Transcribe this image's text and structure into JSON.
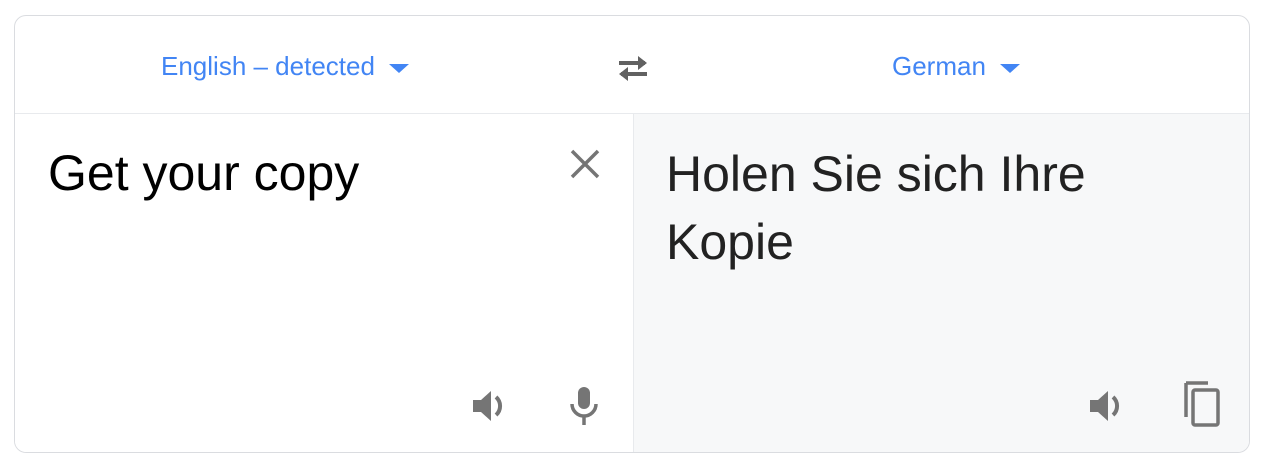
{
  "languages": {
    "source_label": "English – detected",
    "target_label": "German"
  },
  "source": {
    "text": "Get your copy"
  },
  "target": {
    "text": "Holen Sie sich Ihre Kopie"
  },
  "icons": {
    "dropdown": "caret-down-icon",
    "swap": "swap-arrows-icon",
    "clear": "close-icon",
    "speak": "speaker-icon",
    "mic": "microphone-icon",
    "copy": "copy-icon"
  },
  "colors": {
    "accent": "#4285f4",
    "icon": "#757575",
    "target_bg": "#f7f8f9",
    "border": "#dadce0"
  }
}
